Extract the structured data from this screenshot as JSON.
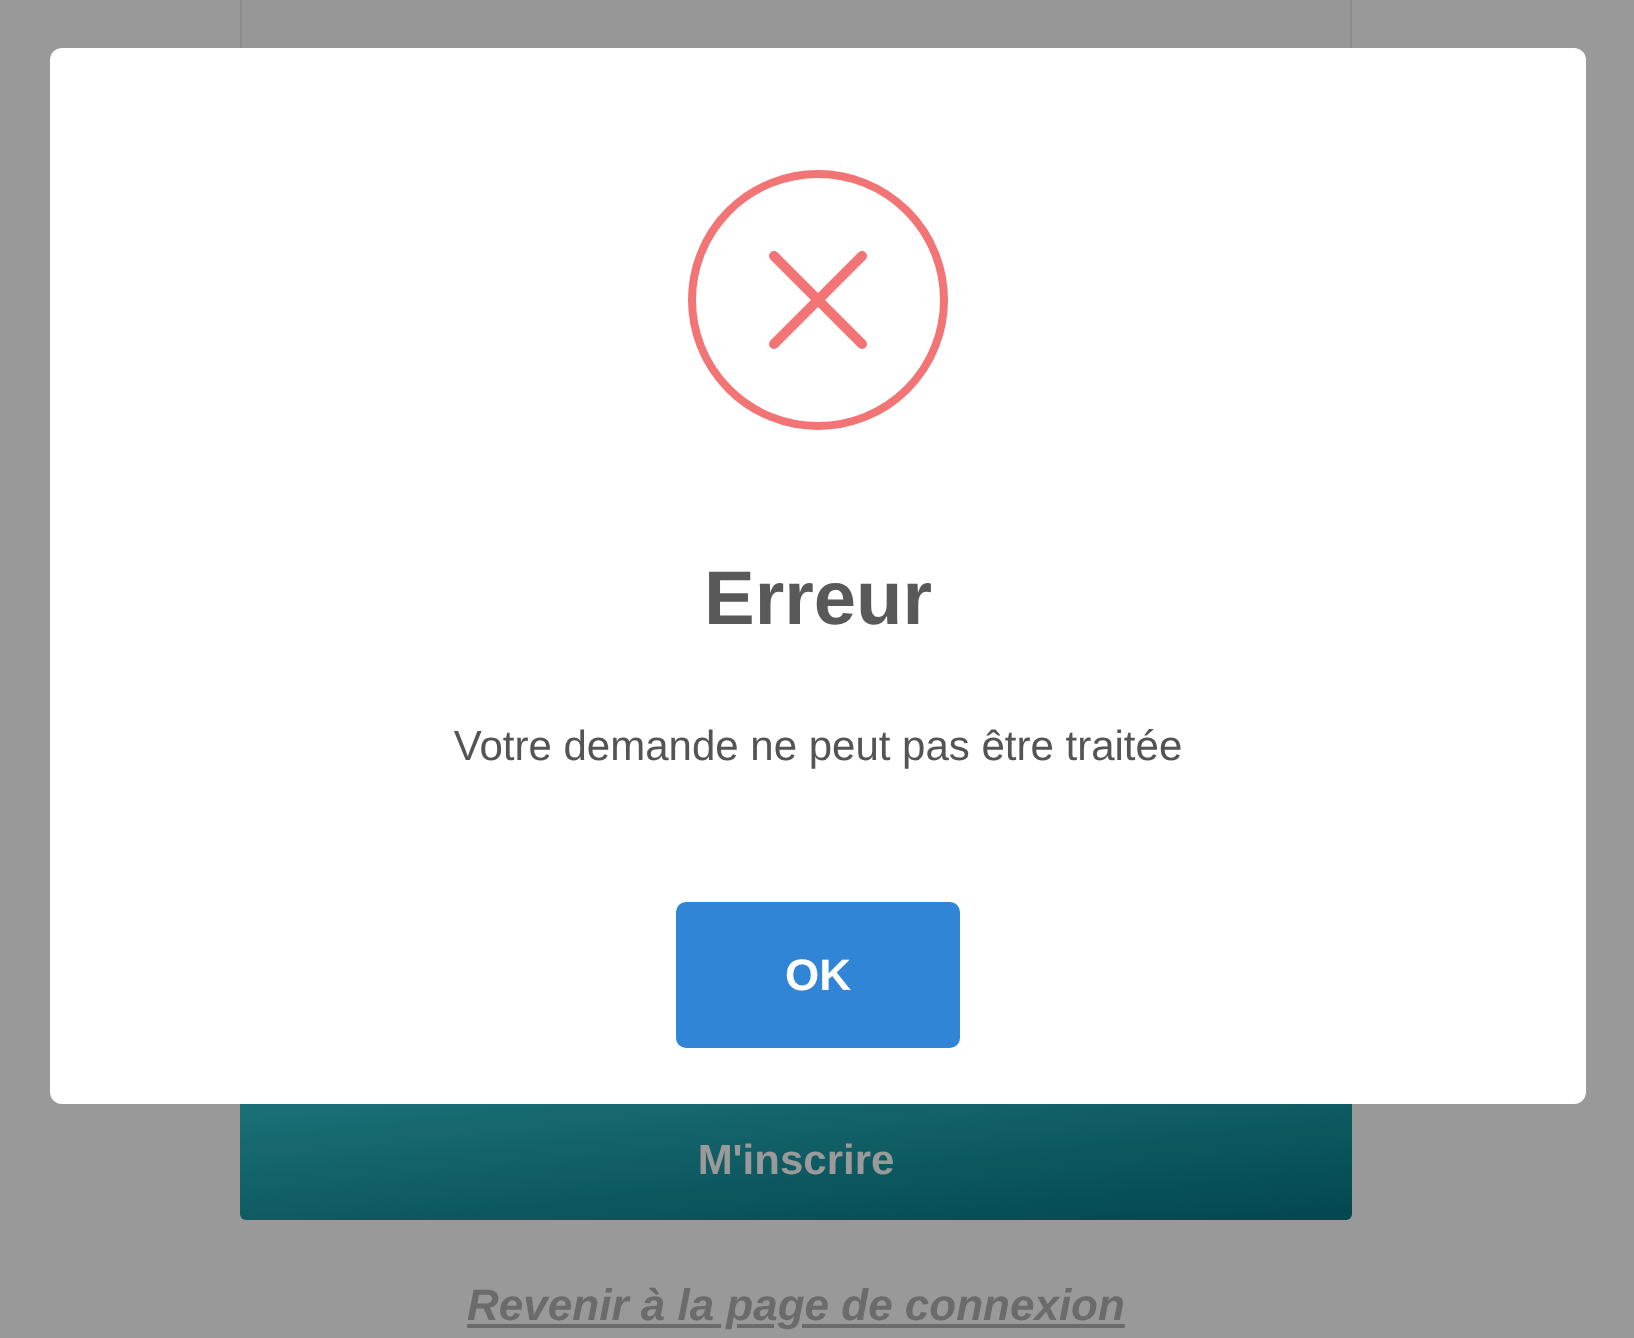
{
  "background": {
    "submit_button": "M'inscrire",
    "login_link": "Revenir à la page de connexion"
  },
  "dialog": {
    "kind": "error",
    "title": "Erreur",
    "message": "Votre demande ne peut pas être traitée",
    "button": "OK"
  }
}
